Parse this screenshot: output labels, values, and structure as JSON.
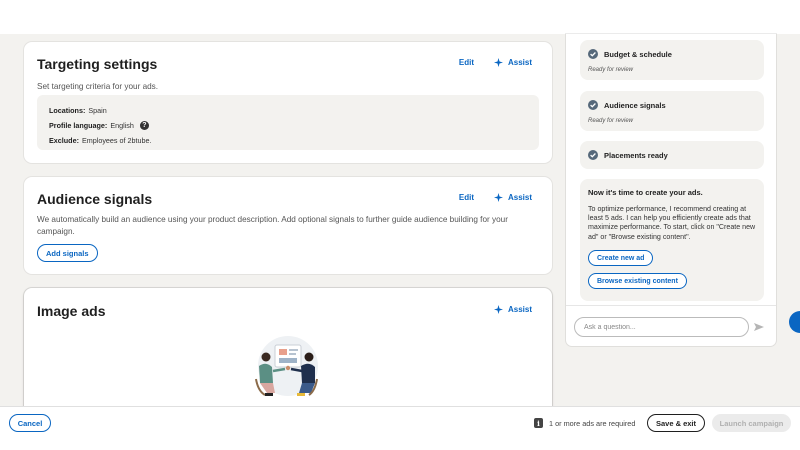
{
  "targeting": {
    "title": "Targeting settings",
    "edit_label": "Edit",
    "assist_label": "Assist",
    "description": "Set targeting criteria for your ads.",
    "locations_label": "Locations:",
    "locations_value": "Spain",
    "language_label": "Profile language:",
    "language_value": "English",
    "exclude_label": "Exclude:",
    "exclude_value": "Employees of 2btube."
  },
  "audience": {
    "title": "Audience signals",
    "edit_label": "Edit",
    "assist_label": "Assist",
    "description": "We automatically build an audience using your product description. Add optional signals to further guide audience building for your campaign.",
    "add_signals_label": "Add signals"
  },
  "image_ads": {
    "title": "Image ads",
    "assist_label": "Assist"
  },
  "assistant": {
    "steps": [
      {
        "title": "Budget & schedule",
        "status": "Ready for review"
      },
      {
        "title": "Audience signals",
        "status": "Ready for review"
      },
      {
        "title": "Placements ready",
        "status": ""
      }
    ],
    "message_title": "Now it's time to create your ads.",
    "message_body": "To optimize performance, I recommend creating at least 5 ads. I can help you efficiently create ads that maximize performance. To start, click on \"Create new ad\" or \"Browse existing content\".",
    "create_label": "Create new ad",
    "browse_label": "Browse existing content",
    "ask_placeholder": "Ask a question..."
  },
  "footer": {
    "cancel_label": "Cancel",
    "requirement_text": "1 or more ads are required",
    "save_exit_label": "Save & exit",
    "launch_label": "Launch campaign"
  },
  "colors": {
    "accent": "#0a66c2",
    "canvas_bg": "#f3f2ef",
    "check_fill": "#56687a"
  },
  "icons": {
    "assist": "sparkle-icon",
    "step": "check-circle-icon",
    "help": "question-circle-icon",
    "send": "send-icon",
    "info": "info-icon"
  }
}
